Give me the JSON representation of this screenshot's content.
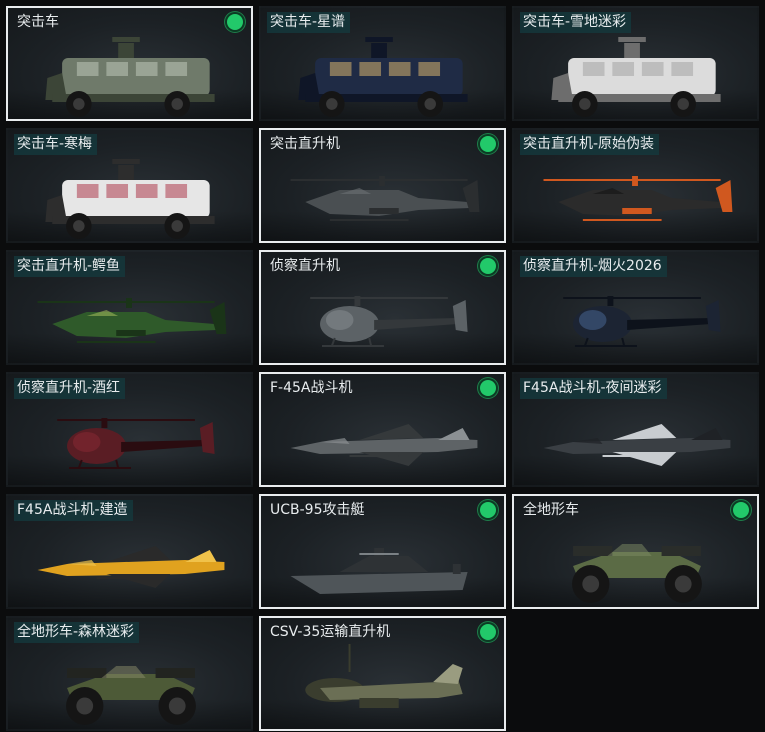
{
  "vehicles": [
    {
      "name": "突击车",
      "owned": true,
      "kind": "truck",
      "colors": [
        "#6f7a6a",
        "#3c4537",
        "#b8bfb2"
      ]
    },
    {
      "name": "突击车-星谱",
      "owned": false,
      "kind": "truck",
      "colors": [
        "#1f2b45",
        "#0f1627",
        "#c6a66a"
      ]
    },
    {
      "name": "突击车-雪地迷彩",
      "owned": false,
      "kind": "truck",
      "colors": [
        "#dcdcdc",
        "#6d6d6d",
        "#a8a8a8"
      ]
    },
    {
      "name": "突击车-寒梅",
      "owned": false,
      "kind": "truck",
      "colors": [
        "#e6e6e6",
        "#2d2d2d",
        "#b24a5a"
      ]
    },
    {
      "name": "突击直升机",
      "owned": true,
      "kind": "attack-heli",
      "colors": [
        "#4a4f52",
        "#2b2e30",
        "#6c7174"
      ]
    },
    {
      "name": "突击直升机-原始伪装",
      "owned": false,
      "kind": "attack-heli",
      "colors": [
        "#2b2b2b",
        "#d0581f",
        "#141414"
      ]
    },
    {
      "name": "突击直升机-鳄鱼",
      "owned": false,
      "kind": "attack-heli",
      "colors": [
        "#2f5a2a",
        "#1a3418",
        "#9cb55a"
      ]
    },
    {
      "name": "侦察直升机",
      "owned": true,
      "kind": "scout-heli",
      "colors": [
        "#5c6266",
        "#34383b",
        "#8a9094"
      ]
    },
    {
      "name": "侦察直升机-烟火2026",
      "owned": false,
      "kind": "scout-heli",
      "colors": [
        "#1c2433",
        "#0d121b",
        "#4a6a9a"
      ]
    },
    {
      "name": "侦察直升机-酒红",
      "owned": false,
      "kind": "scout-heli",
      "colors": [
        "#5a1d24",
        "#2a0c10",
        "#8a2a34"
      ]
    },
    {
      "name": "F-45A战斗机",
      "owned": true,
      "kind": "jet",
      "colors": [
        "#5e6366",
        "#35393b",
        "#8b9093"
      ]
    },
    {
      "name": "F45A战斗机-夜间迷彩",
      "owned": false,
      "kind": "jet",
      "colors": [
        "#3a3f44",
        "#c8ccd0",
        "#1f2226"
      ]
    },
    {
      "name": "F45A战斗机-建造",
      "owned": false,
      "kind": "jet",
      "colors": [
        "#e0a21f",
        "#2a2a2a",
        "#f0c24a"
      ]
    },
    {
      "name": "UCB-95攻击艇",
      "owned": true,
      "kind": "boat",
      "colors": [
        "#4f5559",
        "#2e3235",
        "#7b8185"
      ]
    },
    {
      "name": "全地形车",
      "owned": true,
      "kind": "atv",
      "colors": [
        "#5b6b45",
        "#2a2d2a",
        "#7d8c63"
      ]
    },
    {
      "name": "全地形车-森林迷彩",
      "owned": false,
      "kind": "atv",
      "colors": [
        "#4d5a37",
        "#222420",
        "#8a8c6a"
      ]
    },
    {
      "name": "CSV-35运输直升机",
      "owned": true,
      "kind": "transport-heli",
      "colors": [
        "#6b6f55",
        "#3a3d2e",
        "#9a9c80"
      ]
    }
  ]
}
